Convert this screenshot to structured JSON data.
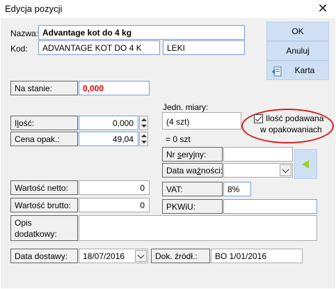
{
  "window": {
    "title": "Edycja pozycji",
    "close_glyph": "✕"
  },
  "buttons": {
    "ok": "OK",
    "cancel": "Anuluj",
    "card": "Karta"
  },
  "header": {
    "name_label": "Nazwa:",
    "name_value": "Advantage kot do 4 kg",
    "code_label": "Kod:",
    "code_value": "ADVANTAGE KOT DO 4 K",
    "group_value": "LEKI"
  },
  "stock": {
    "label": "Na stanie:",
    "value": "0,000"
  },
  "quantity": {
    "label_pre": "I",
    "label_u": "l",
    "label_post": "ość:",
    "value": "0,000"
  },
  "pack_price": {
    "label": "Cena opak.:",
    "value": "49,04"
  },
  "unit": {
    "label": "Jedn. miary:",
    "value": "(4 szt)",
    "eq": "= 0 szt"
  },
  "pack_checkbox": {
    "label_line1": "Ilość podawana",
    "label_line2": "w opakowaniach",
    "checked": true
  },
  "serial": {
    "label_pre": "Nr ",
    "label_u": "s",
    "label_post": "eryjny:",
    "value": ""
  },
  "expiry": {
    "label_pre": "Data wa",
    "label_u": "ż",
    "label_post": "ności:",
    "value": ""
  },
  "net_value": {
    "label": "Wartość netto:",
    "value": "0"
  },
  "vat": {
    "label": "VAT:",
    "value": "8%"
  },
  "gross_value": {
    "label": "Wartość brutto:",
    "value": "0"
  },
  "pkwiu": {
    "label": "PKWiU:",
    "value": ""
  },
  "extra_desc": {
    "label_line1": "Opis",
    "label_line2": "dodatkowy:",
    "value": ""
  },
  "delivery_date": {
    "label": "Data dostawy:",
    "value": "18/07/2016"
  },
  "source_doc": {
    "label": "Dok. źródł.:",
    "value": "BO 1/01/2016"
  },
  "colors": {
    "stock_value": "#e00000",
    "button_bg": "#cfe0f4",
    "highlight_ellipse": "#d42020"
  },
  "icons": [
    "close-icon",
    "card-icon",
    "spin-up-icon",
    "spin-down-icon",
    "chevron-down-icon",
    "arrow-left-icon",
    "checkmark-icon"
  ]
}
